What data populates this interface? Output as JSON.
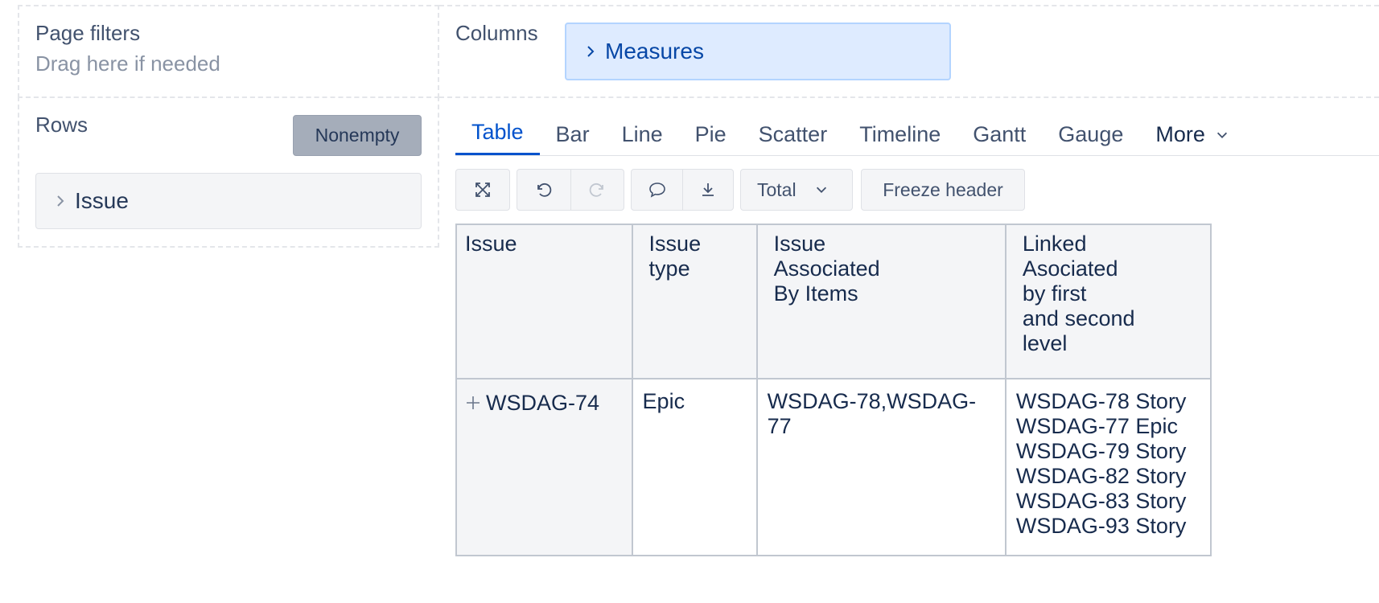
{
  "layout_panel": {
    "page_filters": {
      "title": "Page filters",
      "hint": "Drag here if needed"
    },
    "rows": {
      "title": "Rows",
      "nonempty_label": "Nonempty",
      "dimension_label": "Issue"
    },
    "columns": {
      "title": "Columns",
      "dimension_label": "Measures"
    }
  },
  "view_tabs": {
    "items": [
      "Table",
      "Bar",
      "Line",
      "Pie",
      "Scatter",
      "Timeline",
      "Gantt",
      "Gauge"
    ],
    "more_label": "More",
    "active": "Table"
  },
  "toolbar": {
    "total_label": "Total",
    "freeze_header_label": "Freeze header"
  },
  "report_table": {
    "headers": {
      "issue": "Issue",
      "issue_type": [
        "Issue",
        "type"
      ],
      "associated": [
        "Issue",
        "Associated",
        "By Items"
      ],
      "linked": [
        "Linked",
        "Asociated",
        "by first",
        "and second",
        "level"
      ]
    },
    "row": {
      "issue": "WSDAG-74",
      "issue_type": "Epic",
      "associated": "WSDAG-78,WSDAG-77",
      "linked": [
        "WSDAG-78 Story",
        "WSDAG-77 Epic",
        "WSDAG-79 Story",
        "WSDAG-82 Story",
        "WSDAG-83 Story",
        "WSDAG-93 Story"
      ]
    }
  },
  "colors": {
    "accent": "#0052cc",
    "measures_bg": "#deebff",
    "nonempty_bg": "#a5adba"
  }
}
